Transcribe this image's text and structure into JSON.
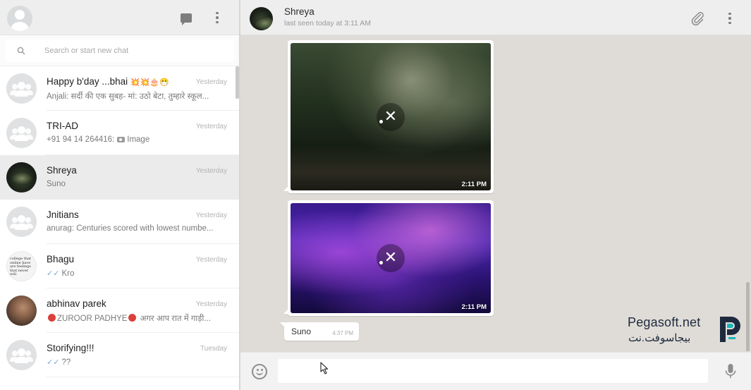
{
  "sidebar": {
    "search": {
      "placeholder": "Search or start new chat"
    },
    "chats": [
      {
        "name": "Happy b'day ...bhai",
        "name_emoji": "💥💥🎂😷",
        "time": "Yesterday",
        "preview": "Anjali: सर्दी की एक सुबह- मां: उठो बेटा, तुम्हारे स्कूल..."
      },
      {
        "name": "TRI-AD",
        "time": "Yesterday",
        "preview_prefix": "+91 94 14 264416:",
        "preview": "Image"
      },
      {
        "name": "Shreya",
        "time": "Yesterday",
        "preview": "Suno"
      },
      {
        "name": "Jnitians",
        "time": "Yesterday",
        "preview": "anurag: Centuries scored with lowest numbe..."
      },
      {
        "name": "Bhagu",
        "time": "Yesterday",
        "preview": "Kro",
        "avatar_text": "college that online have are feelings that never will"
      },
      {
        "name": "abhinav parek",
        "time": "Yesterday",
        "preview_mid": "ZUROOR PADHYE",
        "preview": "अगर आप रात में गाड़ी..."
      },
      {
        "name": "Storifying!!!",
        "time": "Tuesday",
        "preview": "??"
      }
    ]
  },
  "conversation": {
    "contact_name": "Shreya",
    "status": "last seen today at 3:11 AM",
    "messages": [
      {
        "type": "image",
        "time": "2:11 PM",
        "cancel": "✕"
      },
      {
        "type": "image",
        "time": "2:11 PM",
        "cancel": "✕"
      },
      {
        "type": "text",
        "text": "Suno",
        "time": "4:37 PM"
      }
    ],
    "input_value": ""
  },
  "watermark": {
    "brand": "Pegasoft.net",
    "brand_ar": "بيجاسوفت.نت"
  },
  "colors": {
    "sidebar_header": "#eeeeee",
    "conversation_bg": "#dfdcd7",
    "active_chat": "#ebebeb",
    "tick_blue": "#7aa9d6"
  },
  "icons": [
    "new-chat-icon",
    "menu-icon",
    "search-icon",
    "attach-icon",
    "emoji-icon",
    "mic-icon",
    "cancel-icon",
    "group-avatar-icon",
    "camera-icon",
    "double-check-icon"
  ]
}
